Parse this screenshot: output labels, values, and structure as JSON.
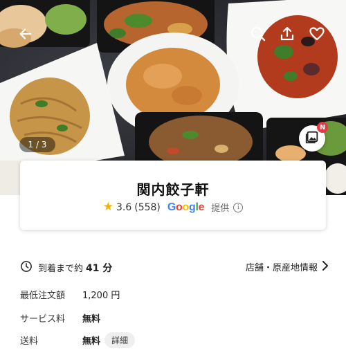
{
  "hero": {
    "pager": "1 / 3",
    "gallery_badge": "N"
  },
  "store": {
    "name": "関内餃子軒",
    "rating": "3.6",
    "review_count": "(558)",
    "google_letters": [
      "G",
      "o",
      "o",
      "g",
      "l",
      "e"
    ],
    "provided_label": "提供",
    "star_color": "#f5b301"
  },
  "delivery": {
    "prefix": "到着まで約",
    "time": "41 分",
    "origin_link": "店舗・原産地情報"
  },
  "fees": [
    {
      "label": "最低注文額",
      "value": "1,200 円"
    },
    {
      "label": "サービス料",
      "value": "無料"
    },
    {
      "label": "送料",
      "value": "無料",
      "detail": "詳細"
    }
  ],
  "icons": {
    "back": "back-arrow-icon",
    "search": "search-icon",
    "share": "share-icon",
    "favorite": "heart-icon",
    "gallery": "gallery-icon",
    "clock": "clock-icon",
    "chevron": "chevron-right-icon",
    "info": "info-icon"
  }
}
